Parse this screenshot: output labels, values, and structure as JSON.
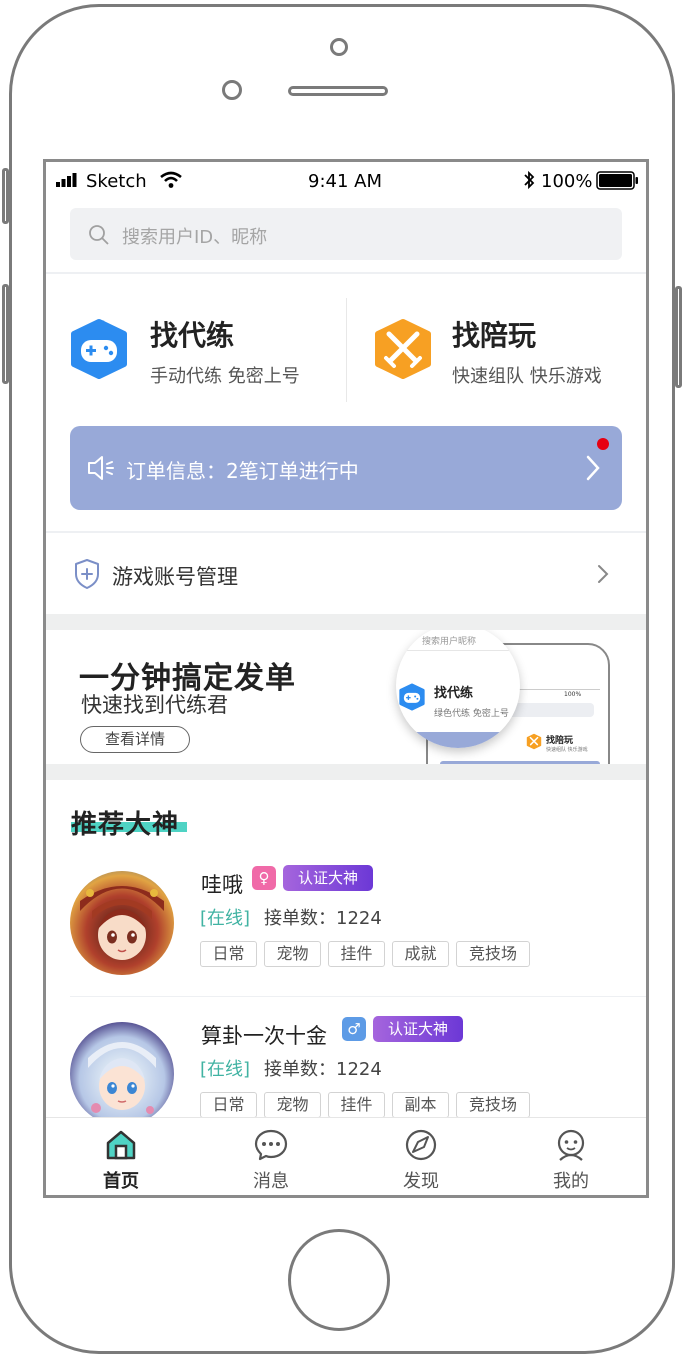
{
  "status_bar": {
    "carrier": "Sketch",
    "time": "9:41 AM",
    "battery": "100%"
  },
  "search": {
    "placeholder": "搜索用户ID、昵称"
  },
  "services": [
    {
      "title": "找代练",
      "subtitle": "手动代练 免密上号",
      "icon": "gamepad-icon"
    },
    {
      "title": "找陪玩",
      "subtitle": "快速组队 快乐游戏",
      "icon": "crossed-swords-icon"
    }
  ],
  "order_banner": {
    "text": "订单信息：2笔订单进行中",
    "has_notification": true
  },
  "account_manage": {
    "label": "游戏账号管理"
  },
  "promo": {
    "title": "一分钟搞定发单",
    "subtitle": "快速找到代练君",
    "button": "查看详情",
    "preview": {
      "search_hint": "搜索用户昵称",
      "card_title": "找代练",
      "card_sub": "绿色代练 免密上号",
      "mini_title": "找陪玩",
      "mini_sub": "快速组队 快乐游戏",
      "mini_battery": "100%"
    }
  },
  "recommend": {
    "title": "推荐大神",
    "users": [
      {
        "name": "哇哦",
        "gender": "female",
        "gender_symbol": "♀",
        "verified": "认证大神",
        "status": "[在线]",
        "orders": "接单数：1224",
        "tags": [
          "日常",
          "宠物",
          "挂件",
          "成就",
          "竞技场"
        ]
      },
      {
        "name": "算卦一次十金",
        "gender": "male",
        "gender_symbol": "♂",
        "verified": "认证大神",
        "status": "[在线]",
        "orders": "接单数：1224",
        "tags": [
          "日常",
          "宠物",
          "挂件",
          "副本",
          "竞技场"
        ]
      }
    ]
  },
  "tabbar": {
    "items": [
      {
        "label": "首页",
        "icon": "home-icon",
        "active": true
      },
      {
        "label": "消息",
        "icon": "chat-bubble-icon",
        "active": false
      },
      {
        "label": "发现",
        "icon": "discover-icon",
        "active": false
      },
      {
        "label": "我的",
        "icon": "profile-icon",
        "active": false
      }
    ]
  },
  "colors": {
    "accent_teal": "#4fd3c4",
    "banner_blue": "#98a9d8",
    "verify_purple": "#8a4fdc",
    "female_pink": "#f06aa8",
    "male_blue": "#5d9be6",
    "online_green": "#41b3a3"
  }
}
